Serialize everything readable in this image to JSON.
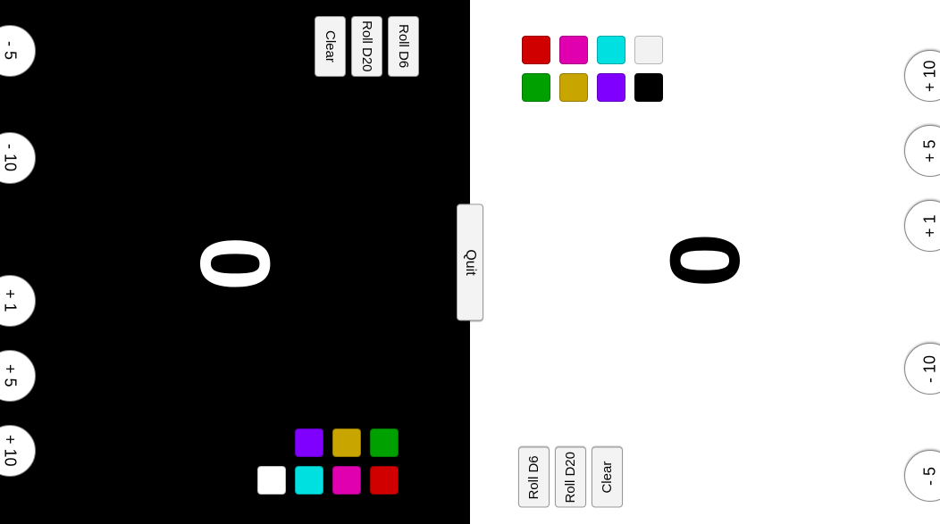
{
  "center": {
    "quit_label": "Quit"
  },
  "left": {
    "score": "0",
    "adj": {
      "minus5": "- 5",
      "minus10": "- 10",
      "plus1": "+ 1",
      "plus5": "+ 5",
      "plus10": "+ 10"
    },
    "dice": {
      "roll_d6": "Roll D6",
      "roll_d20": "Roll D20",
      "clear": "Clear"
    },
    "palette": [
      "#000000",
      "#8000ff",
      "#c9a500",
      "#00a000",
      "#ffffff",
      "#00e0e0",
      "#e000b0",
      "#d00000"
    ]
  },
  "right": {
    "score": "0",
    "adj": {
      "plus10": "+ 10",
      "plus5": "+ 5",
      "plus1": "+ 1",
      "minus10": "- 10",
      "minus5": "- 5"
    },
    "dice": {
      "roll_d6": "Roll D6",
      "roll_d20": "Roll D20",
      "clear": "Clear"
    },
    "palette": [
      "#d00000",
      "#e000b0",
      "#00e0e0",
      "#f2f2f2",
      "#00a000",
      "#c9a500",
      "#8000ff",
      "#000000"
    ]
  }
}
